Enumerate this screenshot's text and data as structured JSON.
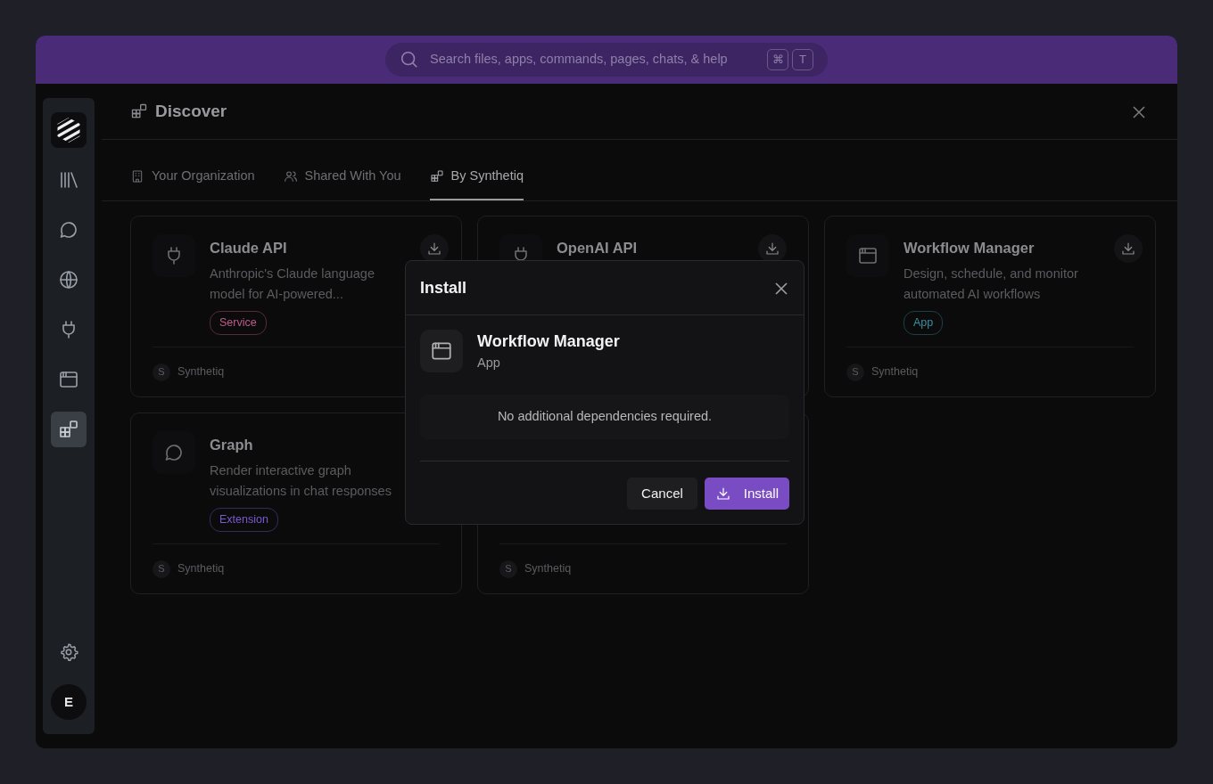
{
  "search": {
    "placeholder": "Search files, apps, commands, pages, chats, & help",
    "keys": [
      "⌘",
      "T"
    ]
  },
  "sidebar": {
    "items": [
      {
        "selected": false
      },
      {
        "selected": false
      },
      {
        "selected": false
      },
      {
        "selected": false
      },
      {
        "selected": false
      },
      {
        "selected": true
      }
    ],
    "avatar": "E"
  },
  "header": {
    "title": "Discover"
  },
  "tabs": [
    {
      "label": "Your Organization",
      "selected": false
    },
    {
      "label": "Shared With You",
      "selected": false
    },
    {
      "label": "By Synthetiq",
      "selected": true
    }
  ],
  "cards": [
    {
      "title": "Claude API",
      "download_button": true,
      "description": "Anthropic's Claude language model for AI-powered...",
      "badge": {
        "label": "Service",
        "color": "#c05a8a"
      },
      "author_initial": "S",
      "author": "Synthetiq"
    },
    {
      "title": "OpenAI API",
      "download_button": true
    },
    {
      "title": "Workflow Manager",
      "download_button": true,
      "description": "Design, schedule, and monitor automated AI workflows",
      "badge": {
        "label": "App",
        "color": "#3a8fa0"
      },
      "author_initial": "S",
      "author": "Synthetiq"
    },
    {
      "title": "Graph",
      "description": "Render interactive graph visualizations in chat responses",
      "badge": {
        "label": "Extension",
        "color": "#7a5ad0"
      },
      "author_initial": "S",
      "author": "Synthetiq"
    },
    {
      "author_initial": "S",
      "author": "Synthetiq"
    }
  ],
  "dialog": {
    "title": "Install",
    "item_name": "Workflow Manager",
    "item_type": "App",
    "message": "No additional dependencies required.",
    "buttons": [
      {
        "label": "Cancel",
        "kind": "secondary"
      },
      {
        "label": "Install",
        "kind": "primary"
      }
    ]
  }
}
